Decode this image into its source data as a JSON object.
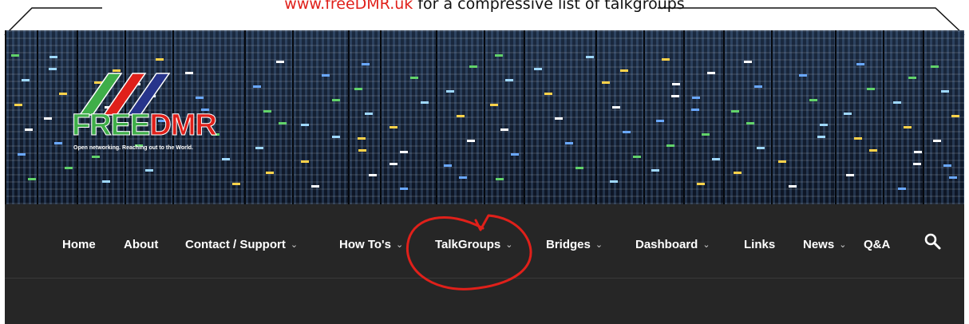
{
  "callout": {
    "link_text": "www.freeDMR.uk",
    "rest_text": " for a compressive list of talkgroups"
  },
  "logo": {
    "word_free": "FREE",
    "word_dmr": "DMR",
    "tagline": "Open networking. Reaching out to the World."
  },
  "nav": {
    "items": [
      {
        "label": "Home",
        "has_dropdown": false
      },
      {
        "label": "About",
        "has_dropdown": false
      },
      {
        "label": "Contact / Support",
        "has_dropdown": true
      },
      {
        "label": "How To's",
        "has_dropdown": true
      },
      {
        "label": "TalkGroups",
        "has_dropdown": true
      },
      {
        "label": "Bridges",
        "has_dropdown": true
      },
      {
        "label": "Dashboard",
        "has_dropdown": true
      },
      {
        "label": "Links",
        "has_dropdown": false
      },
      {
        "label": "News",
        "has_dropdown": true
      },
      {
        "label": "Q&A",
        "has_dropdown": false
      }
    ],
    "search_icon": "search-icon",
    "chevron": "⌄"
  },
  "colors": {
    "link_red": "#e0201a",
    "annotation_red": "#e0201a",
    "nav_bg": "#262626",
    "logo_green": "#3fae49"
  }
}
